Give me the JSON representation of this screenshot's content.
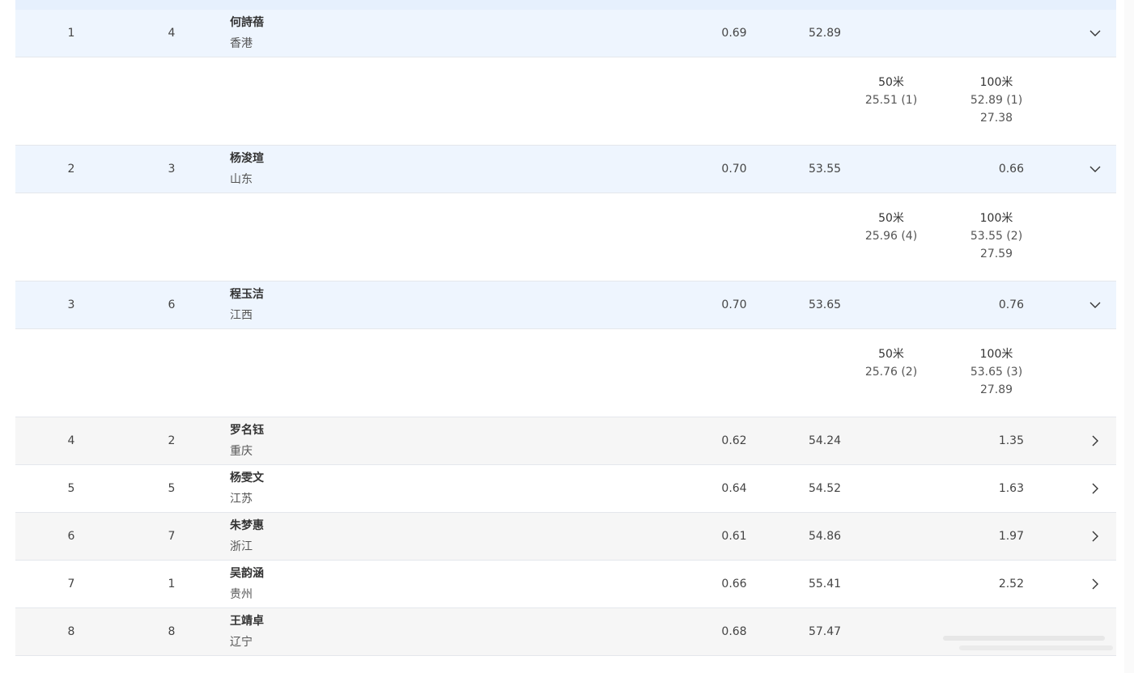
{
  "rows": [
    {
      "rank": "1",
      "lane": "4",
      "name": "何詩蓓",
      "team": "香港",
      "rt": "0.69",
      "time": "52.89",
      "behind": "",
      "state": "expanded",
      "has_toggle": true,
      "splits": [
        {
          "label": "50米",
          "lines": [
            "25.51 (1)"
          ]
        },
        {
          "label": "100米",
          "lines": [
            "52.89 (1)",
            "27.38"
          ]
        }
      ]
    },
    {
      "rank": "2",
      "lane": "3",
      "name": "杨浚瑄",
      "team": "山东",
      "rt": "0.70",
      "time": "53.55",
      "behind": "0.66",
      "state": "expanded",
      "has_toggle": true,
      "splits": [
        {
          "label": "50米",
          "lines": [
            "25.96 (4)"
          ]
        },
        {
          "label": "100米",
          "lines": [
            "53.55 (2)",
            "27.59"
          ]
        }
      ]
    },
    {
      "rank": "3",
      "lane": "6",
      "name": "程玉洁",
      "team": "江西",
      "rt": "0.70",
      "time": "53.65",
      "behind": "0.76",
      "state": "expanded",
      "has_toggle": true,
      "splits": [
        {
          "label": "50米",
          "lines": [
            "25.76 (2)"
          ]
        },
        {
          "label": "100米",
          "lines": [
            "53.65 (3)",
            "27.89"
          ]
        }
      ]
    },
    {
      "rank": "4",
      "lane": "2",
      "name": "罗名钰",
      "team": "重庆",
      "rt": "0.62",
      "time": "54.24",
      "behind": "1.35",
      "state": "collapsed",
      "has_toggle": true,
      "splits": []
    },
    {
      "rank": "5",
      "lane": "5",
      "name": "杨雯文",
      "team": "江苏",
      "rt": "0.64",
      "time": "54.52",
      "behind": "1.63",
      "state": "collapsed",
      "has_toggle": true,
      "splits": []
    },
    {
      "rank": "6",
      "lane": "7",
      "name": "朱梦惠",
      "team": "浙江",
      "rt": "0.61",
      "time": "54.86",
      "behind": "1.97",
      "state": "collapsed",
      "has_toggle": true,
      "splits": []
    },
    {
      "rank": "7",
      "lane": "1",
      "name": "吴韵涵",
      "team": "贵州",
      "rt": "0.66",
      "time": "55.41",
      "behind": "2.52",
      "state": "collapsed",
      "has_toggle": true,
      "splits": []
    },
    {
      "rank": "8",
      "lane": "8",
      "name": "王靖卓",
      "team": "辽宁",
      "rt": "0.68",
      "time": "57.47",
      "behind": "",
      "state": "collapsed",
      "has_toggle": false,
      "splits": []
    }
  ],
  "icons": {
    "expanded": "chevron-down-icon",
    "collapsed": "chevron-right-icon"
  },
  "colors": {
    "expanded_bg": "#eef5fe",
    "alt_bg": "#f6f6f6",
    "border": "#e4e7ec",
    "text": "#444444"
  }
}
